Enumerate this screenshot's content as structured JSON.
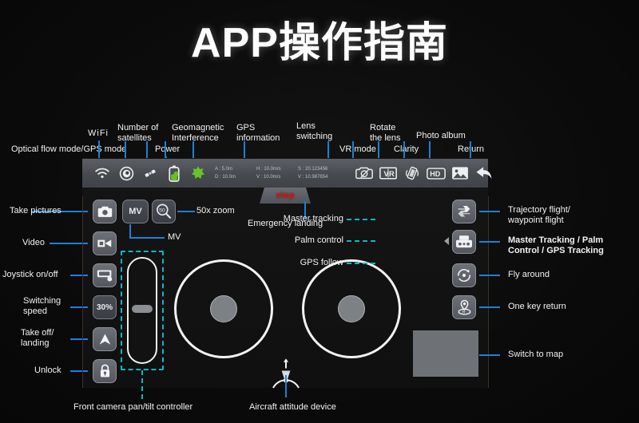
{
  "title": "APP操作指南",
  "toolbar": {
    "icons": [
      {
        "name": "wifi-icon",
        "label": "WiFi"
      },
      {
        "name": "optical-flow-gps-mode-icon",
        "label": "Optical flow mode/GPS mode"
      },
      {
        "name": "satellite-icon",
        "label": "Number of satellites"
      },
      {
        "name": "battery-icon",
        "label": "Power"
      },
      {
        "name": "geomagnetic-interference-icon",
        "label": "Geomagnetic interference"
      },
      {
        "name": "camera-icon",
        "label": "Lens switching"
      },
      {
        "name": "vr-mode-icon",
        "label": "VR mode"
      },
      {
        "name": "rotate-lens-icon",
        "label": "Rotate the lens"
      },
      {
        "name": "hd-clarity-icon",
        "label": "Clarity"
      },
      {
        "name": "photo-album-icon",
        "label": "Photo album"
      },
      {
        "name": "return-icon",
        "label": "Return"
      }
    ],
    "telemetry": {
      "alt_label": "A : 5.0m",
      "dist_label": "D : 10.0m",
      "h_speed_label": "H : 10.0m/s",
      "v_speed_label": "V : 10.0m/s",
      "lat_label": "S : 20.123456",
      "lon_label": "V : 10.987654"
    }
  },
  "top_labels": [
    {
      "name": "label-optical-flow-gps-mode",
      "text": "Optical flow mode/GPS mode"
    },
    {
      "name": "label-wifi",
      "text": "WiFi"
    },
    {
      "name": "label-number-of-satellites",
      "text": "Number of\nsatellites"
    },
    {
      "name": "label-power",
      "text": "Power"
    },
    {
      "name": "label-geomagnetic-interference",
      "text": "Geomagnetic\nInterference"
    },
    {
      "name": "label-gps-information",
      "text": "GPS\ninformation"
    },
    {
      "name": "label-lens-switching",
      "text": "Lens\nswitching"
    },
    {
      "name": "label-vr-mode",
      "text": "VR mode"
    },
    {
      "name": "label-rotate-the-lens",
      "text": "Rotate\nthe lens"
    },
    {
      "name": "label-clarity",
      "text": "Clarity"
    },
    {
      "name": "label-photo-album",
      "text": "Photo album"
    },
    {
      "name": "label-return",
      "text": "Return"
    }
  ],
  "left_controls": [
    {
      "name": "take-pictures",
      "label": "Take pictures",
      "icon": "camera-icon"
    },
    {
      "name": "video",
      "label": "Video",
      "icon": "video-icon"
    },
    {
      "name": "joystick-on-off",
      "label": "Joystick on/off",
      "icon": "joystick-icon"
    },
    {
      "name": "switching-speed",
      "label": "Switching\nspeed",
      "icon": "percent-30",
      "value": "30%"
    },
    {
      "name": "take-off-landing",
      "label": "Take off/\nlanding",
      "icon": "up-arrow-icon"
    },
    {
      "name": "unlock",
      "label": "Unlock",
      "icon": "lock-icon"
    }
  ],
  "mv_button": {
    "label": "MV",
    "caption": "MV"
  },
  "zoom_button": {
    "value": "50",
    "caption": "50x zoom"
  },
  "emergency": {
    "button_text": "stop",
    "caption": "Emergency landing"
  },
  "center_dashed_labels": [
    {
      "name": "label-master-tracking",
      "text": "Master tracking"
    },
    {
      "name": "label-palm-control",
      "text": "Palm control"
    },
    {
      "name": "label-gps-follow",
      "text": "GPS follow"
    }
  ],
  "right_controls": [
    {
      "name": "trajectory-waypoint-flight",
      "label": "Trajectory flight/\nwaypoint flight",
      "icon": "waypoint-icon"
    },
    {
      "name": "master-tracking-palm-gps",
      "label": "Master Tracking / Palm\nControl / GPS Tracking",
      "icon": "remote-controller-icon"
    },
    {
      "name": "fly-around",
      "label": "Fly around",
      "icon": "orbit-icon"
    },
    {
      "name": "one-key-return",
      "label": "One key return",
      "icon": "home-pin-icon"
    },
    {
      "name": "switch-to-map",
      "label": "Switch to map",
      "icon": "map-thumbnail"
    }
  ],
  "bottom_labels": [
    {
      "name": "label-front-camera-pan-tilt",
      "text": "Front camera pan/tilt controller"
    },
    {
      "name": "label-aircraft-attitude-device",
      "text": "Aircraft attitude device"
    }
  ],
  "colors": {
    "accent_blue": "#1f7fd4",
    "accent_cyan": "#10b5c4",
    "stop_red": "#e8120c",
    "toolbar_gray": "#4a4e54",
    "background": "#0c0c0c"
  }
}
